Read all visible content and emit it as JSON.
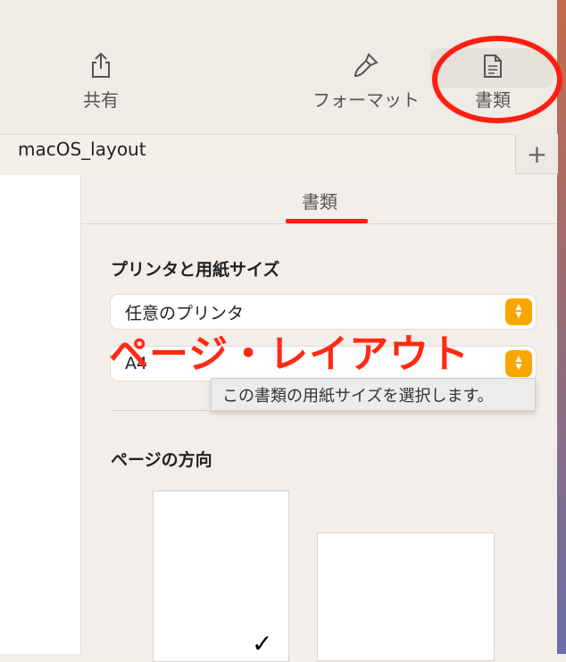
{
  "toolbar": {
    "share_label": "共有",
    "format_label": "フォーマット",
    "document_label": "書類"
  },
  "tab": {
    "title": "macOS_layout",
    "add_label": "+"
  },
  "inspector": {
    "tab_label": "書類",
    "printer_section": "プリンタと用紙サイズ",
    "printer_value": "任意のプリンタ",
    "paper_value": "A4",
    "tooltip": "この書類の用紙サイズを選択します。",
    "orientation_section": "ページの方向"
  },
  "annotation": {
    "text": "ページ・レイアウト",
    "color": "#ff2a12"
  },
  "colors": {
    "highlight_ring": "#ff1e10",
    "stepper": "#f9a700"
  }
}
